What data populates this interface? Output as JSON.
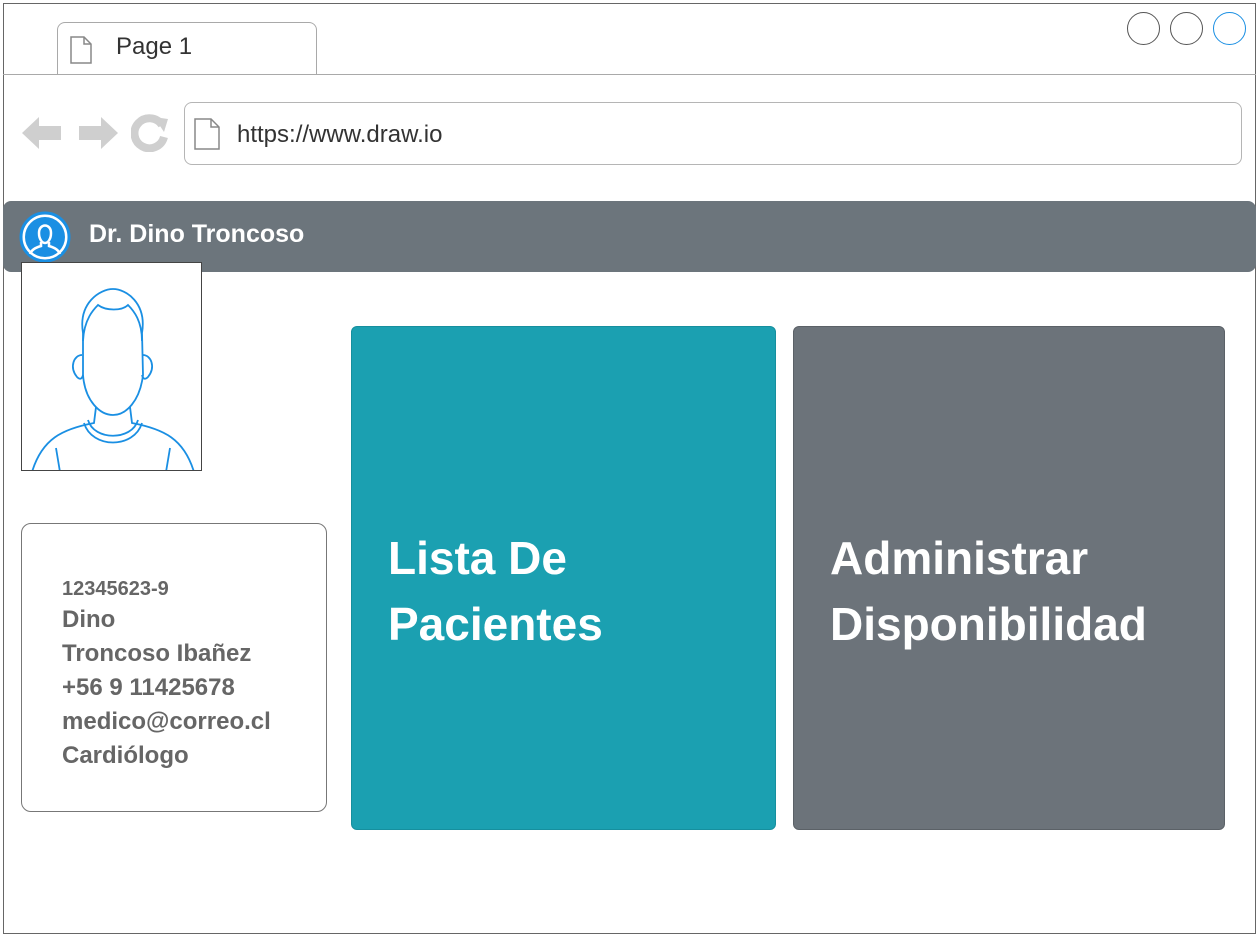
{
  "browser": {
    "tab_label": "Page 1",
    "url": "https://www.draw.io"
  },
  "header": {
    "doctor_name": "Dr. Dino Troncoso"
  },
  "profile": {
    "rut": "12345623-9",
    "first_name": "Dino",
    "last_names": "Troncoso Ibañez",
    "phone": "+56 9 11425678",
    "email": "medico@correo.cl",
    "specialty": "Cardiólogo"
  },
  "tiles": {
    "patients_line1": "Lista De",
    "patients_line2": "Pacientes",
    "availability_line1": "Administrar",
    "availability_line2": "Disponibilidad"
  },
  "colors": {
    "header_bar": "#6c757c",
    "patients_tile": "#1ba0b1",
    "availability_tile": "#6c737a",
    "accent": "#1a8fe3"
  },
  "icons": [
    "document-icon",
    "back-arrow-icon",
    "forward-arrow-icon",
    "reload-icon",
    "user-circle-icon",
    "user-avatar-icon"
  ]
}
